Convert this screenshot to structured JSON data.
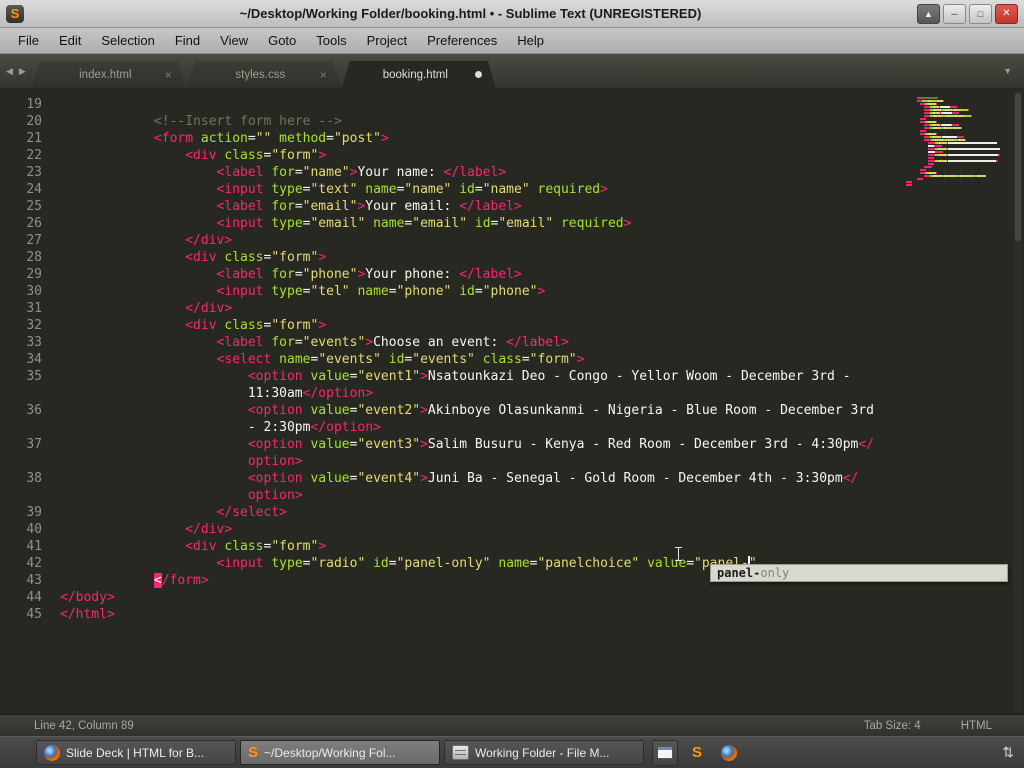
{
  "window": {
    "title": "~/Desktop/Working Folder/booking.html • - Sublime Text (UNREGISTERED)",
    "controls": [
      {
        "name": "shade",
        "glyph": "▲"
      },
      {
        "name": "minimize",
        "glyph": "─"
      },
      {
        "name": "maximize",
        "glyph": "□"
      },
      {
        "name": "close",
        "glyph": "✕"
      }
    ]
  },
  "icons": {
    "sublime_glyph": "S"
  },
  "menu": [
    "File",
    "Edit",
    "Selection",
    "Find",
    "View",
    "Goto",
    "Tools",
    "Project",
    "Preferences",
    "Help"
  ],
  "tabbar": {
    "back": "◀",
    "forward": "▶",
    "overflow": "▼",
    "close_glyph": "×"
  },
  "tabs": [
    {
      "label": "index.html",
      "active": false,
      "modified": false
    },
    {
      "label": "styles.css",
      "active": false,
      "modified": false
    },
    {
      "label": "booking.html",
      "active": true,
      "modified": true
    }
  ],
  "editor": {
    "rows": [
      {
        "num": "19",
        "segs": []
      },
      {
        "num": "20",
        "segs": [
          [
            "w",
            "            "
          ],
          [
            "c",
            "<!--Insert form here -->"
          ]
        ]
      },
      {
        "num": "21",
        "segs": [
          [
            "w",
            "            "
          ],
          [
            "t",
            "<form "
          ],
          [
            "a",
            "action"
          ],
          [
            "w",
            "="
          ],
          [
            "s",
            "\"\" "
          ],
          [
            "a",
            "method"
          ],
          [
            "w",
            "="
          ],
          [
            "s",
            "\"post\""
          ],
          [
            "t",
            ">"
          ]
        ]
      },
      {
        "num": "22",
        "segs": [
          [
            "w",
            "                "
          ],
          [
            "t",
            "<div "
          ],
          [
            "a",
            "class"
          ],
          [
            "w",
            "="
          ],
          [
            "s",
            "\"form\""
          ],
          [
            "t",
            ">"
          ]
        ]
      },
      {
        "num": "23",
        "segs": [
          [
            "w",
            "                    "
          ],
          [
            "t",
            "<label "
          ],
          [
            "a",
            "for"
          ],
          [
            "w",
            "="
          ],
          [
            "s",
            "\"name\""
          ],
          [
            "t",
            ">"
          ],
          [
            "w",
            "Your name: "
          ],
          [
            "t",
            "</label>"
          ]
        ]
      },
      {
        "num": "24",
        "segs": [
          [
            "w",
            "                    "
          ],
          [
            "t",
            "<input "
          ],
          [
            "a",
            "type"
          ],
          [
            "w",
            "="
          ],
          [
            "s",
            "\"text\" "
          ],
          [
            "a",
            "name"
          ],
          [
            "w",
            "="
          ],
          [
            "s",
            "\"name\" "
          ],
          [
            "a",
            "id"
          ],
          [
            "w",
            "="
          ],
          [
            "s",
            "\"name\" "
          ],
          [
            "a",
            "required"
          ],
          [
            "t",
            ">"
          ]
        ]
      },
      {
        "num": "25",
        "segs": [
          [
            "w",
            "                    "
          ],
          [
            "t",
            "<label "
          ],
          [
            "a",
            "for"
          ],
          [
            "w",
            "="
          ],
          [
            "s",
            "\"email\""
          ],
          [
            "t",
            ">"
          ],
          [
            "w",
            "Your email: "
          ],
          [
            "t",
            "</label>"
          ]
        ]
      },
      {
        "num": "26",
        "segs": [
          [
            "w",
            "                    "
          ],
          [
            "t",
            "<input "
          ],
          [
            "a",
            "type"
          ],
          [
            "w",
            "="
          ],
          [
            "s",
            "\"email\" "
          ],
          [
            "a",
            "name"
          ],
          [
            "w",
            "="
          ],
          [
            "s",
            "\"email\" "
          ],
          [
            "a",
            "id"
          ],
          [
            "w",
            "="
          ],
          [
            "s",
            "\"email\" "
          ],
          [
            "a",
            "required"
          ],
          [
            "t",
            ">"
          ]
        ]
      },
      {
        "num": "27",
        "segs": [
          [
            "w",
            "                "
          ],
          [
            "t",
            "</div>"
          ]
        ]
      },
      {
        "num": "28",
        "segs": [
          [
            "w",
            "                "
          ],
          [
            "t",
            "<div "
          ],
          [
            "a",
            "class"
          ],
          [
            "w",
            "="
          ],
          [
            "s",
            "\"form\""
          ],
          [
            "t",
            ">"
          ]
        ]
      },
      {
        "num": "29",
        "segs": [
          [
            "w",
            "                    "
          ],
          [
            "t",
            "<label "
          ],
          [
            "a",
            "for"
          ],
          [
            "w",
            "="
          ],
          [
            "s",
            "\"phone\""
          ],
          [
            "t",
            ">"
          ],
          [
            "w",
            "Your phone: "
          ],
          [
            "t",
            "</label>"
          ]
        ]
      },
      {
        "num": "30",
        "segs": [
          [
            "w",
            "                    "
          ],
          [
            "t",
            "<input "
          ],
          [
            "a",
            "type"
          ],
          [
            "w",
            "="
          ],
          [
            "s",
            "\"tel\" "
          ],
          [
            "a",
            "name"
          ],
          [
            "w",
            "="
          ],
          [
            "s",
            "\"phone\" "
          ],
          [
            "a",
            "id"
          ],
          [
            "w",
            "="
          ],
          [
            "s",
            "\"phone\""
          ],
          [
            "t",
            ">"
          ]
        ]
      },
      {
        "num": "31",
        "segs": [
          [
            "w",
            "                "
          ],
          [
            "t",
            "</div>"
          ]
        ]
      },
      {
        "num": "32",
        "segs": [
          [
            "w",
            "                "
          ],
          [
            "t",
            "<div "
          ],
          [
            "a",
            "class"
          ],
          [
            "w",
            "="
          ],
          [
            "s",
            "\"form\""
          ],
          [
            "t",
            ">"
          ]
        ]
      },
      {
        "num": "33",
        "segs": [
          [
            "w",
            "                    "
          ],
          [
            "t",
            "<label "
          ],
          [
            "a",
            "for"
          ],
          [
            "w",
            "="
          ],
          [
            "s",
            "\"events\""
          ],
          [
            "t",
            ">"
          ],
          [
            "w",
            "Choose an event: "
          ],
          [
            "t",
            "</label>"
          ]
        ]
      },
      {
        "num": "34",
        "segs": [
          [
            "w",
            "                    "
          ],
          [
            "t",
            "<select "
          ],
          [
            "a",
            "name"
          ],
          [
            "w",
            "="
          ],
          [
            "s",
            "\"events\" "
          ],
          [
            "a",
            "id"
          ],
          [
            "w",
            "="
          ],
          [
            "s",
            "\"events\" "
          ],
          [
            "a",
            "class"
          ],
          [
            "w",
            "="
          ],
          [
            "s",
            "\"form\""
          ],
          [
            "t",
            ">"
          ]
        ]
      },
      {
        "num": "35",
        "segs": [
          [
            "w",
            "                        "
          ],
          [
            "t",
            "<option "
          ],
          [
            "a",
            "value"
          ],
          [
            "w",
            "="
          ],
          [
            "s",
            "\"event1\""
          ],
          [
            "t",
            ">"
          ],
          [
            "w",
            "Nsatounkazi Deo - Congo - Yellor Woom - December 3rd -"
          ]
        ]
      },
      {
        "num": "",
        "segs": [
          [
            "w",
            "                        "
          ],
          [
            "w",
            "11:30am"
          ],
          [
            "t",
            "</option>"
          ]
        ]
      },
      {
        "num": "36",
        "segs": [
          [
            "w",
            "                        "
          ],
          [
            "t",
            "<option "
          ],
          [
            "a",
            "value"
          ],
          [
            "w",
            "="
          ],
          [
            "s",
            "\"event2\""
          ],
          [
            "t",
            ">"
          ],
          [
            "w",
            "Akinboye Olasunkanmi - Nigeria - Blue Room - December 3rd"
          ]
        ]
      },
      {
        "num": "",
        "segs": [
          [
            "w",
            "                        "
          ],
          [
            "w",
            "- 2:30pm"
          ],
          [
            "t",
            "</option>"
          ]
        ]
      },
      {
        "num": "37",
        "segs": [
          [
            "w",
            "                        "
          ],
          [
            "t",
            "<option "
          ],
          [
            "a",
            "value"
          ],
          [
            "w",
            "="
          ],
          [
            "s",
            "\"event3\""
          ],
          [
            "t",
            ">"
          ],
          [
            "w",
            "Salim Busuru - Kenya - Red Room - December 3rd - 4:30pm"
          ],
          [
            "t",
            "</"
          ]
        ]
      },
      {
        "num": "",
        "segs": [
          [
            "w",
            "                        "
          ],
          [
            "t",
            "option>"
          ]
        ]
      },
      {
        "num": "38",
        "segs": [
          [
            "w",
            "                        "
          ],
          [
            "t",
            "<option "
          ],
          [
            "a",
            "value"
          ],
          [
            "w",
            "="
          ],
          [
            "s",
            "\"event4\""
          ],
          [
            "t",
            ">"
          ],
          [
            "w",
            "Juni Ba - Senegal - Gold Room - December 4th - 3:30pm"
          ],
          [
            "t",
            "</"
          ]
        ]
      },
      {
        "num": "",
        "segs": [
          [
            "w",
            "                        "
          ],
          [
            "t",
            "option>"
          ]
        ]
      },
      {
        "num": "39",
        "segs": [
          [
            "w",
            "                    "
          ],
          [
            "t",
            "</select>"
          ]
        ]
      },
      {
        "num": "40",
        "segs": [
          [
            "w",
            "                "
          ],
          [
            "t",
            "</div>"
          ]
        ]
      },
      {
        "num": "41",
        "segs": [
          [
            "w",
            "                "
          ],
          [
            "t",
            "<div "
          ],
          [
            "a",
            "class"
          ],
          [
            "w",
            "="
          ],
          [
            "s",
            "\"form\""
          ],
          [
            "t",
            ">"
          ]
        ]
      },
      {
        "num": "42",
        "segs": [
          [
            "w",
            "                    "
          ],
          [
            "t",
            "<input "
          ],
          [
            "a",
            "type"
          ],
          [
            "w",
            "="
          ],
          [
            "s",
            "\"radio\" "
          ],
          [
            "a",
            "id"
          ],
          [
            "w",
            "="
          ],
          [
            "s",
            "\"panel-only\" "
          ],
          [
            "a",
            "name"
          ],
          [
            "w",
            "="
          ],
          [
            "s",
            "\"panelchoice\" "
          ],
          [
            "a",
            "value"
          ],
          [
            "w",
            "="
          ],
          [
            "s",
            "\"panel-"
          ],
          [
            "cur",
            ""
          ],
          [
            "s",
            "\""
          ]
        ]
      },
      {
        "num": "43",
        "segs": [
          [
            "w",
            "            "
          ],
          [
            "hl",
            "<"
          ],
          [
            "t",
            "/form>"
          ]
        ]
      },
      {
        "num": "44",
        "segs": [
          [
            "t",
            "</body>"
          ]
        ]
      },
      {
        "num": "45",
        "segs": [
          [
            "t",
            "</html>"
          ]
        ]
      }
    ]
  },
  "autocomplete": {
    "match": "panel-",
    "rest": "only"
  },
  "status": {
    "position": "Line 42, Column 89",
    "tab_size": "Tab Size: 4",
    "syntax": "HTML"
  },
  "taskbar": {
    "buttons": [
      {
        "icon": "firefox",
        "label": "Slide Deck | HTML for B...",
        "active": false
      },
      {
        "icon": "sublime",
        "label": "~/Desktop/Working Fol...",
        "active": true
      },
      {
        "icon": "filemanager",
        "label": "Working Folder - File M...",
        "active": false
      }
    ],
    "launchers": [
      "window",
      "sublime",
      "firefox"
    ],
    "indicator": "⇅"
  },
  "colors": {
    "editor-bg": "#272822",
    "tag": "#f92672",
    "attr": "#a6e22e",
    "string": "#e6db74",
    "text": "#f8f8f2",
    "comment": "#75715e",
    "line-number": "#8f908a",
    "sublime-orange": "#ff9800"
  }
}
